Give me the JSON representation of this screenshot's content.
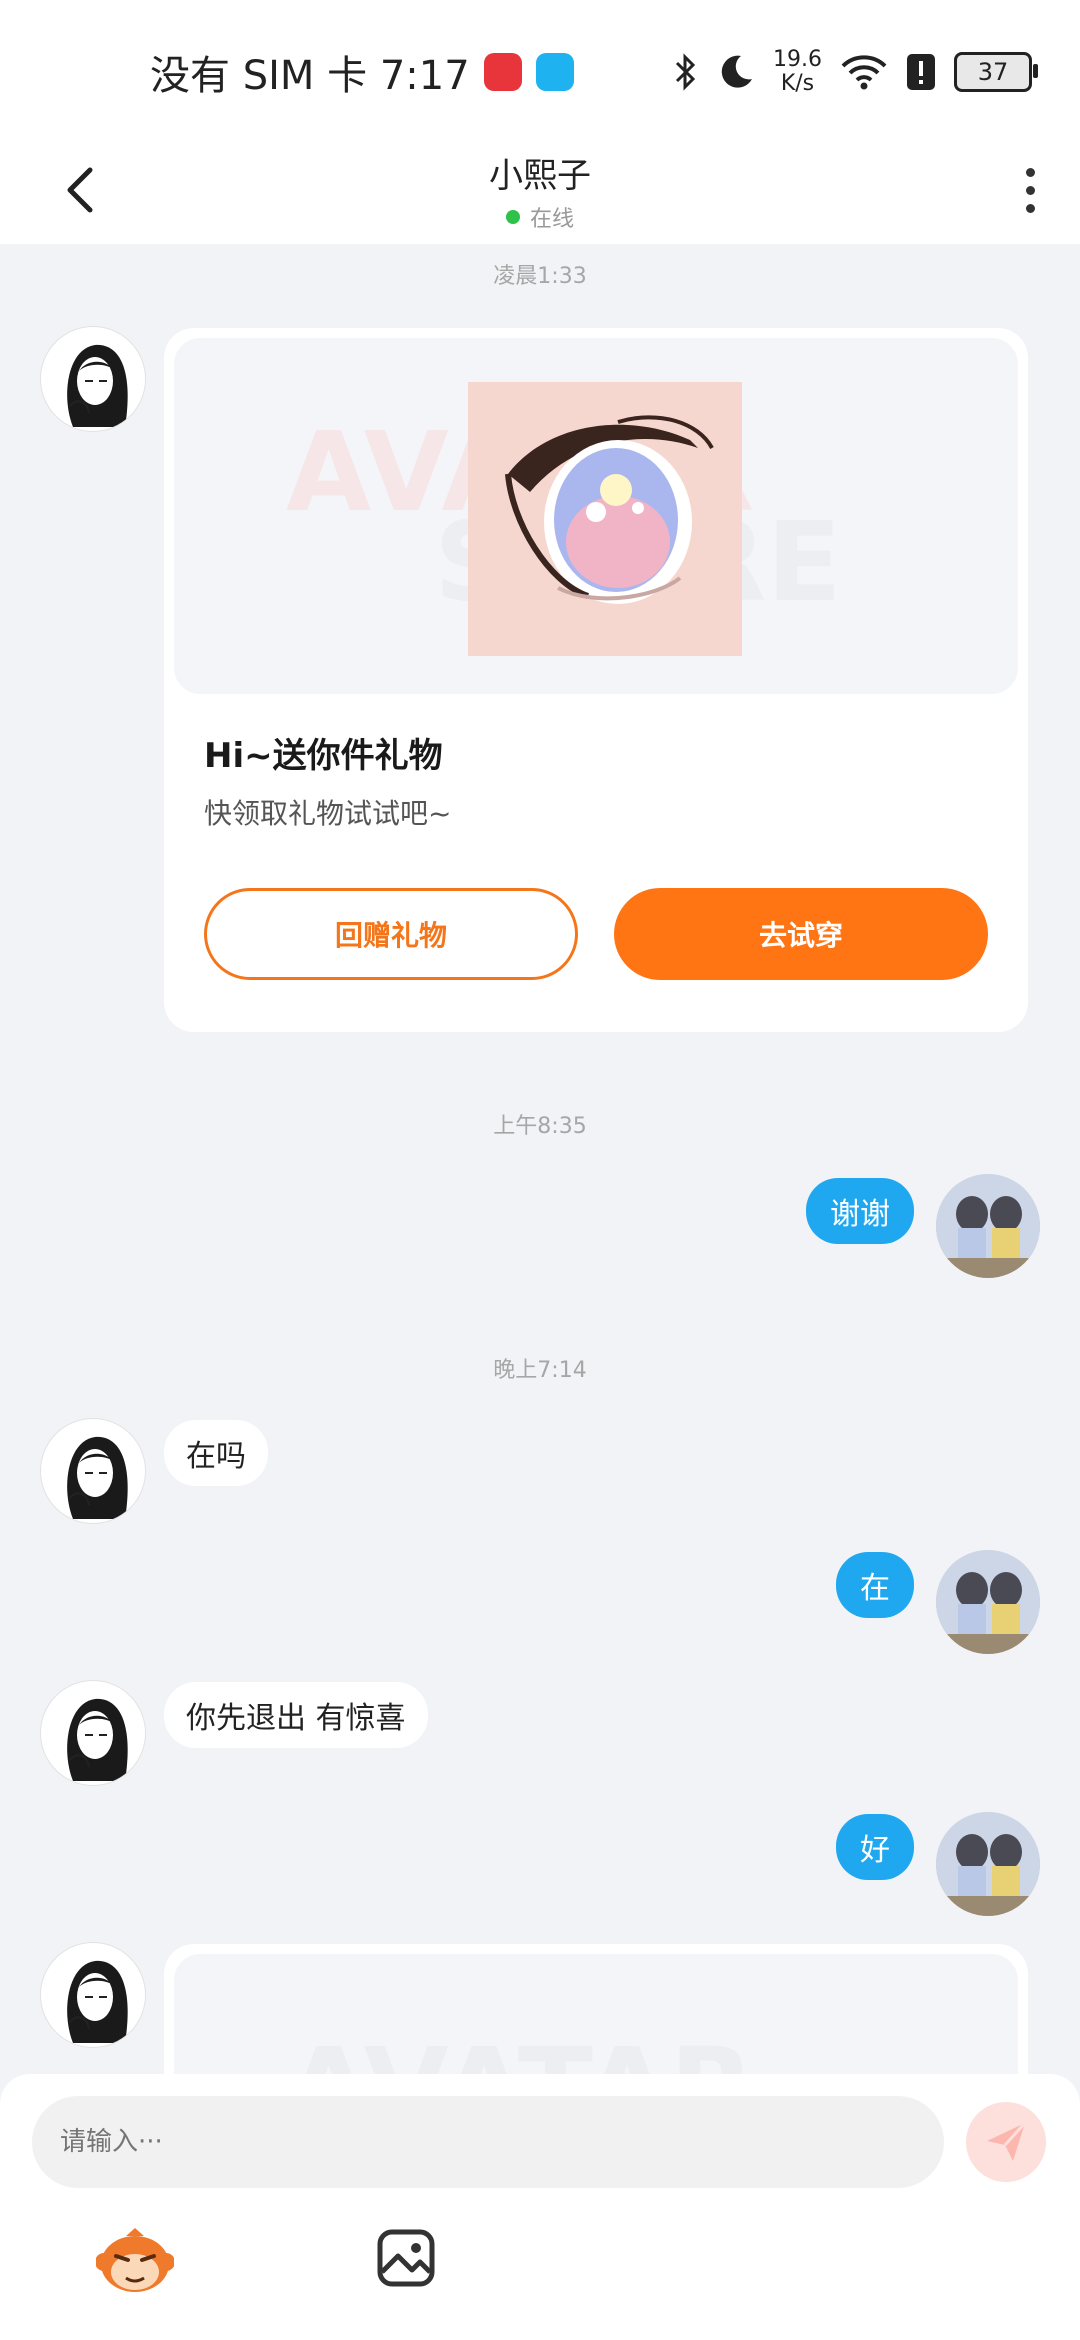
{
  "status_bar": {
    "carrier_time": "没有 SIM 卡 7:17",
    "speed_value": "19.6",
    "speed_unit": "K/s",
    "battery": "37"
  },
  "header": {
    "title": "小熙子",
    "status": "在线"
  },
  "messages": {
    "time1": "凌晨1:33",
    "gift_title": "Hi~送你件礼物",
    "gift_subtitle": "快领取礼物试试吧~",
    "gift_return_label": "回赠礼物",
    "gift_try_label": "去试穿",
    "time2": "上午8:35",
    "msg1": "谢谢",
    "time3": "晚上7:14",
    "msg2": "在吗",
    "msg3": "在",
    "msg4": "你先退出 有惊喜",
    "msg5": "好"
  },
  "watermark": {
    "line1": "AVATAR",
    "line2": "STORE"
  },
  "input": {
    "placeholder": "请输入···"
  },
  "colors": {
    "accent_orange": "#ff7514",
    "bubble_blue": "#1fa8f0",
    "online_green": "#2fc24a"
  }
}
